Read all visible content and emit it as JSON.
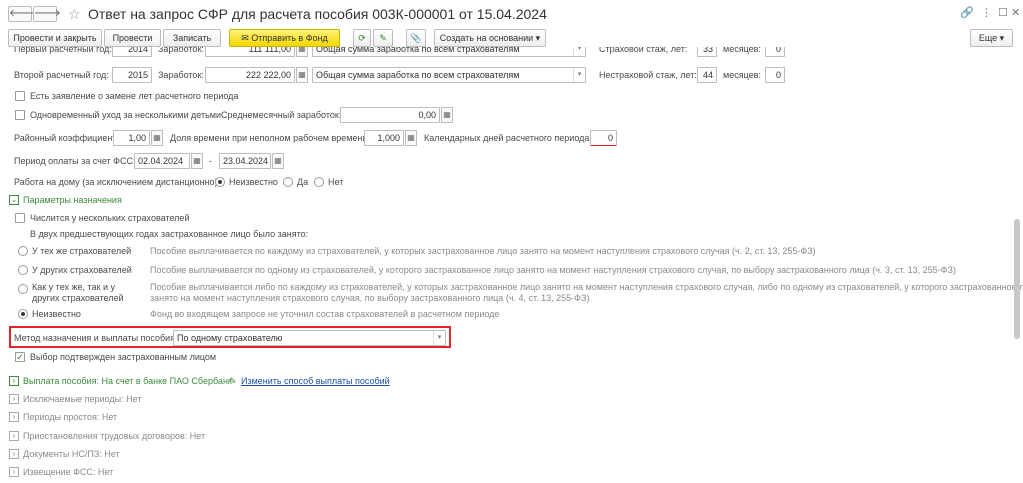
{
  "window": {
    "title": "Ответ на запрос СФР для расчета пособия 003К-000001 от 15.04.2024",
    "back_icon": "arrow-left-icon",
    "forward_icon": "arrow-right-icon"
  },
  "toolbar": {
    "post_close": "Провести и закрыть",
    "post": "Провести",
    "write": "Записать",
    "send": "Отправить в Фонд",
    "create_based": "Создать на основании",
    "more": "Еще"
  },
  "row1": {
    "label": "Первый расчетный год:",
    "year": "2014",
    "earn_label": "Заработок:",
    "earn": "111 111,00",
    "type": "Общая сумма заработка по всем страхователям",
    "ins_label": "Страховой стаж, лет:",
    "ins_years": "33",
    "months_label": "месяцев:",
    "months": "0"
  },
  "row2": {
    "label": "Второй расчетный год:",
    "year": "2015",
    "earn_label": "Заработок:",
    "earn": "222 222,00",
    "type": "Общая сумма заработка по всем страхователям",
    "ins_label": "Нестраховой стаж, лет:",
    "ins_years": "44",
    "months_label": "месяцев:",
    "months": "0"
  },
  "replace_stmt": "Есть заявление о замене лет расчетного периода",
  "multi_child": {
    "label": "Одновременный уход за несколькими детьми",
    "avg_label": "Среднемесячный заработок:",
    "avg": "0,00"
  },
  "district": {
    "label": "Районный коэффициент:",
    "value": "1,00",
    "time_label": "Доля времени при неполном рабочем времени:",
    "time": "1,000",
    "days_label": "Календарных дней расчетного периода:",
    "days": "0"
  },
  "period": {
    "label": "Период оплаты за счет ФСС:",
    "from": "02.04.2024",
    "dash": "-",
    "to": "23.04.2024"
  },
  "home": {
    "label": "Работа на дому (за исключением дистанционно):",
    "opt1": "Неизвестно",
    "opt2": "Да",
    "opt3": "Нет"
  },
  "params": {
    "title": "Параметры назначения",
    "several": "Числится у нескольких страхователей",
    "two_years": "В двух предшествующих годах застрахованное лицо было занято:",
    "options": [
      {
        "label": "У тех же страхователей",
        "desc": "Пособие выплачивается по каждому из страхователей, у которых застрахованное лицо занято на момент наступления страхового случая (ч. 2, ст. 13, 255-ФЗ)"
      },
      {
        "label": "У других страхователей",
        "desc": "Пособие выплачивается по одному из страхователей, у которого застрахованное лицо занято на момент наступления страхового случая, по выбору застрахованного лица (ч. 3, ст. 13, 255-ФЗ)"
      },
      {
        "label1": "Как у тех же, так и у",
        "label2": "других страхователей",
        "desc1": "Пособие выплачивается либо по каждому из страхователей, у которых застрахованное лицо занято на момент наступления страхового случая, либо по одному из страхователей, у которого застрахованное лицо",
        "desc2": "занято на момент наступления страхового случая, по выбору застрахованного лица (ч. 4, ст. 13, 255-ФЗ)"
      },
      {
        "label": "Неизвестно",
        "desc": "Фонд во входящем запросе не уточнил состав страхователей в расчетном периоде"
      }
    ],
    "method_label": "Метод назначения и выплаты пособия:",
    "method_value": "По одному страхователю",
    "confirmed": "Выбор подтвержден застрахованным лицом"
  },
  "payment": {
    "label": "Выплата пособия: На счет в банке ПАО Сбербанк",
    "link": "Изменить способ выплаты пособий"
  },
  "sections": [
    "Исключаемые периоды: Нет",
    "Периоды простоя: Нет",
    "Приостановления трудовых договоров: Нет",
    "Документы НС/ПЗ: Нет",
    "Извещение ФСС: Нет"
  ],
  "colors": {
    "highlight": "#e0242a",
    "accent_green": "#3e8a3e",
    "link": "#1a4fa8",
    "send_button": "#f5d800"
  }
}
